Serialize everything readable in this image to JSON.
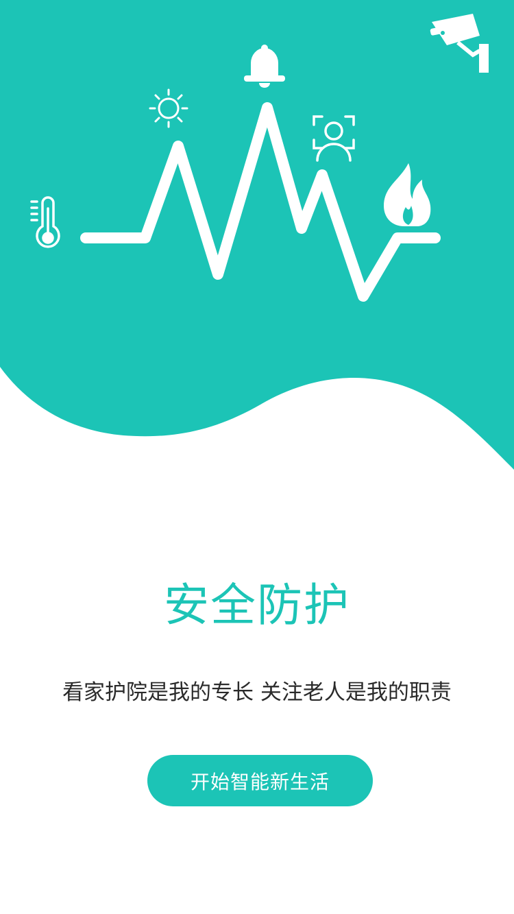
{
  "colors": {
    "accent": "#1cc4b6",
    "white": "#ffffff",
    "text_dark": "#2a2a2a"
  },
  "hero": {
    "icons": [
      "thermometer-icon",
      "sun-icon",
      "bell-icon",
      "face-recognition-icon",
      "fire-icon",
      "security-camera-icon"
    ]
  },
  "main": {
    "title": "安全防护",
    "subtitle": "看家护院是我的专长 关注老人是我的职责",
    "cta_label": "开始智能新生活"
  }
}
